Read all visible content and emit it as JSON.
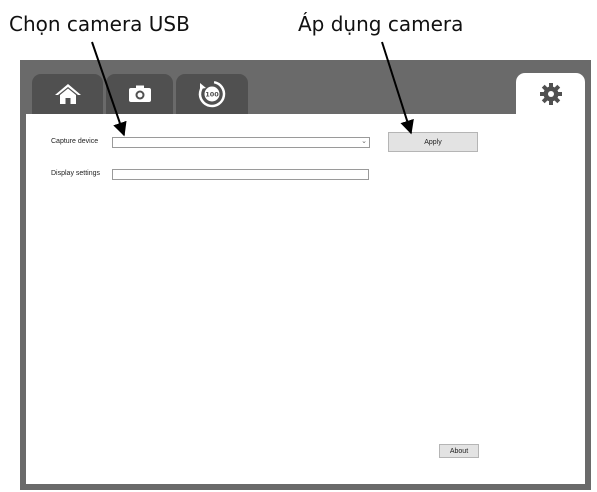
{
  "annotations": {
    "select_usb_camera": "Chọn camera USB",
    "apply_camera": "Áp dụng camera"
  },
  "tabs": [
    {
      "name": "home",
      "icon": "home-icon"
    },
    {
      "name": "camera",
      "icon": "camera-icon"
    },
    {
      "name": "counter",
      "icon": "timer-100-icon",
      "badge": "100"
    },
    {
      "name": "settings",
      "icon": "gear-icon",
      "active": true
    }
  ],
  "settings": {
    "capture_device_label": "Capture device",
    "capture_device_value": "",
    "display_settings_label": "Display settings",
    "display_settings_value": "",
    "apply_label": "Apply",
    "about_label": "About"
  },
  "colors": {
    "frame": "#6a6a6a",
    "tab_inactive": "#505050",
    "tab_active": "#ffffff",
    "button": "#e3e3e3"
  }
}
